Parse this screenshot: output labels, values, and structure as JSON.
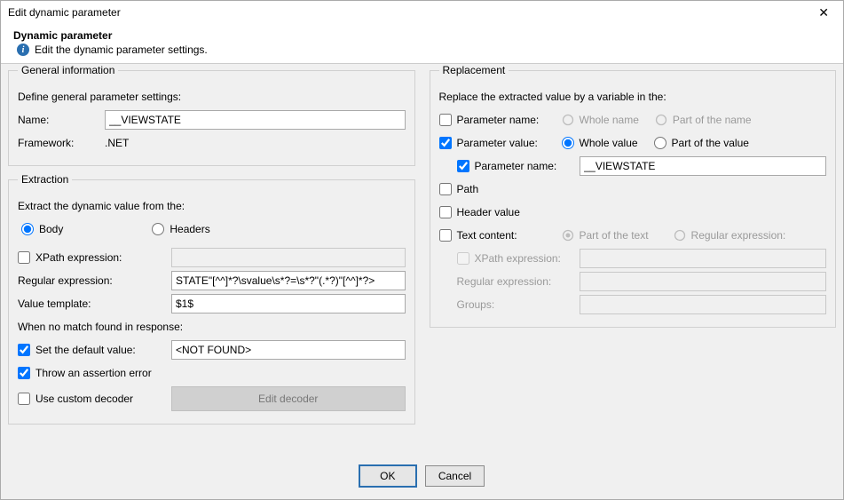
{
  "window": {
    "title": "Edit dynamic parameter"
  },
  "header": {
    "title": "Dynamic parameter",
    "subtitle": "Edit the dynamic parameter settings."
  },
  "general": {
    "legend": "General information",
    "intro": "Define general parameter settings:",
    "name_label": "Name:",
    "name_value": "__VIEWSTATE",
    "framework_label": "Framework:",
    "framework_value": ".NET"
  },
  "extraction": {
    "legend": "Extraction",
    "intro": "Extract the dynamic value from the:",
    "body_label": "Body",
    "headers_label": "Headers",
    "xpath_label": "XPath expression:",
    "xpath_value": "",
    "regex_label": "Regular expression:",
    "regex_value": "STATE\"[^^]*?\\svalue\\s*?=\\s*?\"(.*?)\"[^^]*?>",
    "valtpl_label": "Value template:",
    "valtpl_value": "$1$",
    "nomatch_label": "When no match found in response:",
    "default_label": "Set the default value:",
    "default_value": "<NOT FOUND>",
    "assert_label": "Throw an assertion error",
    "decoder_label": "Use custom decoder",
    "edit_decoder_btn": "Edit decoder"
  },
  "replacement": {
    "legend": "Replacement",
    "intro": "Replace the extracted value by a variable in the:",
    "pname_label": "Parameter name:",
    "pname_whole": "Whole name",
    "pname_part": "Part of the name",
    "pvalue_label": "Parameter value:",
    "pvalue_whole": "Whole value",
    "pvalue_part": "Part of the value",
    "pvalue_pname_label": "Parameter name:",
    "pvalue_pname_value": "__VIEWSTATE",
    "path_label": "Path",
    "header_label": "Header value",
    "text_label": "Text content:",
    "text_partof": "Part of the text",
    "text_regex_radio": "Regular expression:",
    "text_xpath_label": "XPath expression:",
    "text_regex_label": "Regular expression:",
    "text_groups_label": "Groups:"
  },
  "footer": {
    "ok": "OK",
    "cancel": "Cancel"
  }
}
